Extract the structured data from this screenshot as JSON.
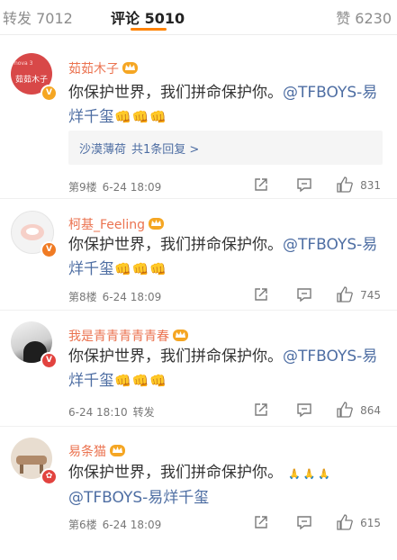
{
  "tabs": {
    "repost": "转发 7012",
    "comments": "评论 5010",
    "likes": "赞 6230"
  },
  "comments": [
    {
      "avatar_text": "茹茹木子",
      "avatar_small": "nova 3",
      "username": "茹茹木子",
      "text": "你保护世界，我们拼命保护你。",
      "mention": "@TFBOYS-易烊千玺",
      "emoji": "👊👊👊",
      "reply": {
        "user": "沙漠薄荷",
        "count": "共1条回复 >"
      },
      "floor": "第9楼",
      "time": "6-24 18:09",
      "likes": "831"
    },
    {
      "username": "柯基_Feeling",
      "text": "你保护世界，我们拼命保护你。",
      "mention": "@TFBOYS-易烊千玺",
      "emoji": "👊👊👊",
      "floor": "第8楼",
      "time": "6-24 18:09",
      "likes": "745"
    },
    {
      "username": "我是青青青青青春",
      "text": "你保护世界，我们拼命保护你。",
      "mention": "@TFBOYS-易烊千玺",
      "emoji": "👊👊👊",
      "time": "6-24 18:10",
      "repost_label": "转发",
      "likes": "864"
    },
    {
      "username": "易条猫",
      "text": "你保护世界，我们拼命保护你。",
      "mention": "@TFBOYS-易烊千玺",
      "emoji": "🙏🙏🙏",
      "floor": "第6楼",
      "time": "6-24 18:09",
      "likes": "615"
    }
  ],
  "colors": {
    "accent": "#ff8200",
    "username": "#eb7350",
    "link": "#4e6ea3",
    "vip_gold": "#f5a623",
    "emoji_fist": "#f5b400"
  },
  "icons": {
    "crown": "vip-crown-icon",
    "share": "share-icon",
    "comment": "comment-icon",
    "like": "thumbs-up-icon"
  }
}
